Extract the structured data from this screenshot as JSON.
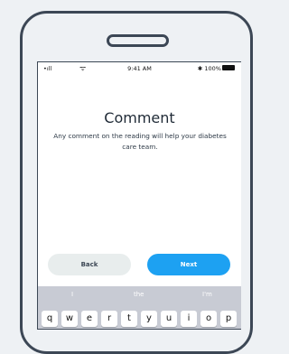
{
  "status": {
    "signal": "•ıll",
    "wifi": "ᯤ",
    "time": "9:41 AM",
    "battery": "✱ 100%"
  },
  "screen": {
    "title": "Comment",
    "description": "Any comment on the reading will help your diabetes care team."
  },
  "buttons": {
    "back": "Back",
    "next": "Next"
  },
  "keyboard": {
    "suggestions": [
      "I",
      "the",
      "I'm"
    ],
    "row1": [
      "q",
      "w",
      "e",
      "r",
      "t",
      "y",
      "u",
      "i",
      "o",
      "p"
    ]
  }
}
